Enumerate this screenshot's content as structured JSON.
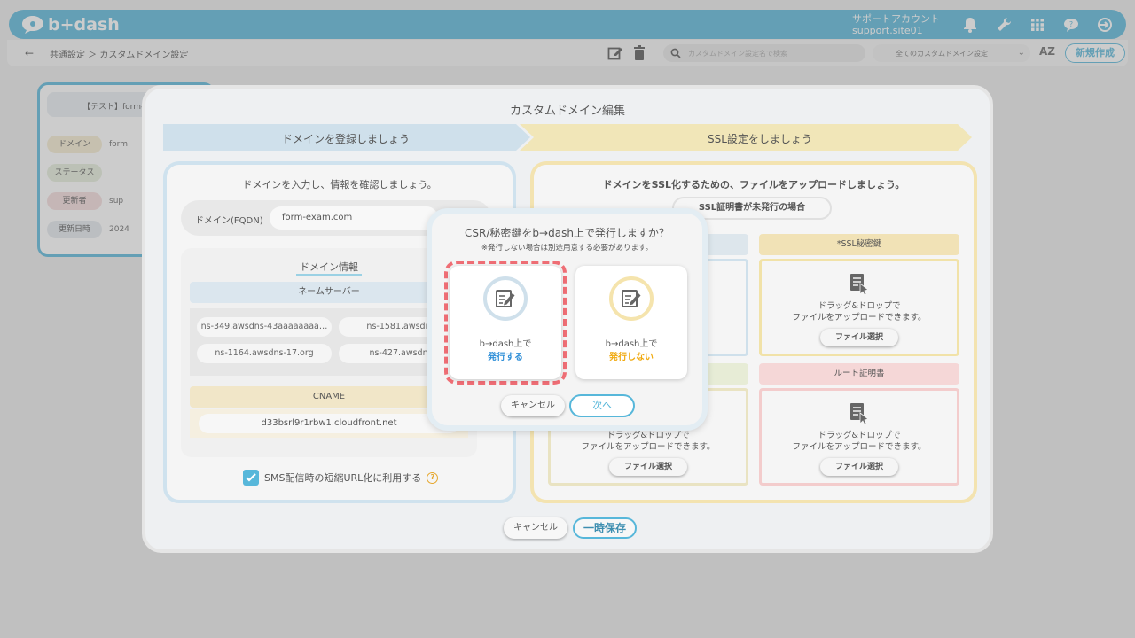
{
  "app": {
    "logo_text": "b+dash",
    "account_line1": "サポートアカウント",
    "account_line2": "support.site01"
  },
  "toolbar": {
    "back_icon": "←",
    "breadcrumb": "共通設定 ＞ カスタムドメイン設定",
    "search_placeholder": "カスタムドメイン設定名で検索",
    "filter_value": "全てのカスタムドメイン設定",
    "sort_label": "AZ",
    "new_button": "新規作成"
  },
  "bg_card": {
    "title": "【テスト】form-e",
    "rows": [
      {
        "label": "ドメイン",
        "value": "form",
        "color": "#f5ecd0"
      },
      {
        "label": "ステータス",
        "value": "",
        "color": "#e6eedb"
      },
      {
        "label": "更新者",
        "value": "sup",
        "color": "#f4dcdc"
      },
      {
        "label": "更新日時",
        "value": "2024",
        "color": "#e4e9ee"
      }
    ]
  },
  "modal": {
    "title": "カスタムドメイン編集",
    "step1": "ドメインを登録しましょう",
    "step2": "SSL設定をしましょう",
    "left": {
      "heading": "ドメインを入力し、情報を確認しましょう。",
      "fqdn_label": "ドメイン(FQDN)",
      "fqdn_value": "form-exam.com",
      "info_title": "ドメイン情報",
      "nameserver_head": "ネームサーバー",
      "nameservers": [
        "ns-349.awsdns-43aaaaaaaa…",
        "ns-1581.awsdns",
        "ns-1164.awsdns-17.org",
        "ns-427.awsdns"
      ],
      "cname_head": "CNAME",
      "cname_value": "d33bsrl9r1rbw1.cloudfront.net",
      "sms_label": "SMS配信時の短縮URL化に利用する",
      "help": "?"
    },
    "right": {
      "heading": "ドメインをSSL化するための、ファイルをアップロードしましょう。",
      "badge": "SSL証明書が未発行の場合",
      "private_key_head": "*SSL秘密鍵",
      "root_cert_head": "ルート証明書",
      "upload_line1": "ドラッグ&ドロップで",
      "upload_line2": "ファイルをアップロードできます。",
      "partial_line1": "ドラッグ&ドロップで",
      "file_button": "ファイル選択"
    },
    "cancel": "キャンセル",
    "save": "一時保存"
  },
  "dialog": {
    "question": "CSR/秘密鍵をb→dash上で発行しますか？",
    "note": "※発行しない場合は別途用意する必要があります。",
    "option_issue_line1": "b→dash上で",
    "option_issue_line2": "発行する",
    "option_no_issue_line1": "b→dash上で",
    "option_no_issue_line2": "発行しない",
    "cancel": "キャンセル",
    "next": "次へ"
  },
  "colors": {
    "brand": "#57b7da",
    "issue": "#2f8fd8",
    "no_issue": "#f0a90e",
    "selection": "#ef6e75"
  }
}
